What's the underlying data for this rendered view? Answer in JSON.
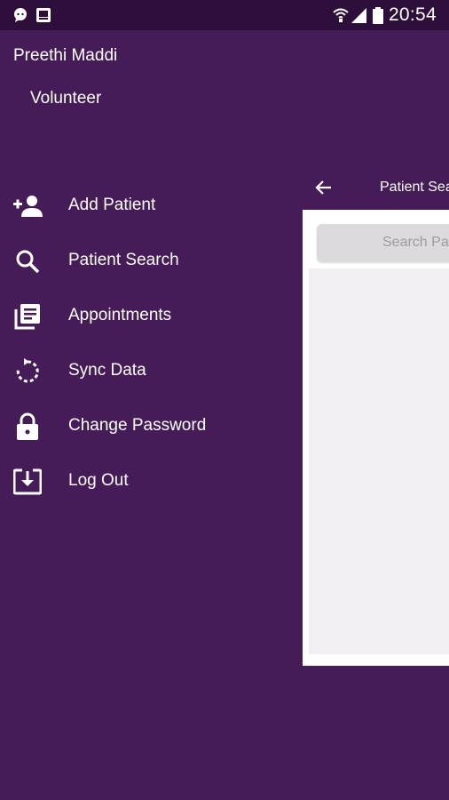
{
  "status_bar": {
    "time": "20:54",
    "icons": [
      "chat-bubble-icon",
      "image-icon",
      "wifi-icon",
      "signal-icon",
      "battery-icon"
    ]
  },
  "drawer": {
    "user_name": "Preethi Maddi",
    "user_role": "Volunteer",
    "items": [
      {
        "label": "Add Patient",
        "icon": "add-person-icon"
      },
      {
        "label": "Patient Search",
        "icon": "search-icon"
      },
      {
        "label": "Appointments",
        "icon": "library-books-icon"
      },
      {
        "label": "Sync Data",
        "icon": "sync-icon"
      },
      {
        "label": "Change Password",
        "icon": "lock-icon"
      },
      {
        "label": "Log Out",
        "icon": "download-box-icon"
      }
    ]
  },
  "background_screen": {
    "title": "Patient Search",
    "search_placeholder": "Search Patient"
  },
  "colors": {
    "drawer_background": "#451C58",
    "status_bar": "#2E0F3B",
    "text": "#FFFFFF",
    "panel_background": "#F1EFF2",
    "search_box": "#DCDADD"
  }
}
